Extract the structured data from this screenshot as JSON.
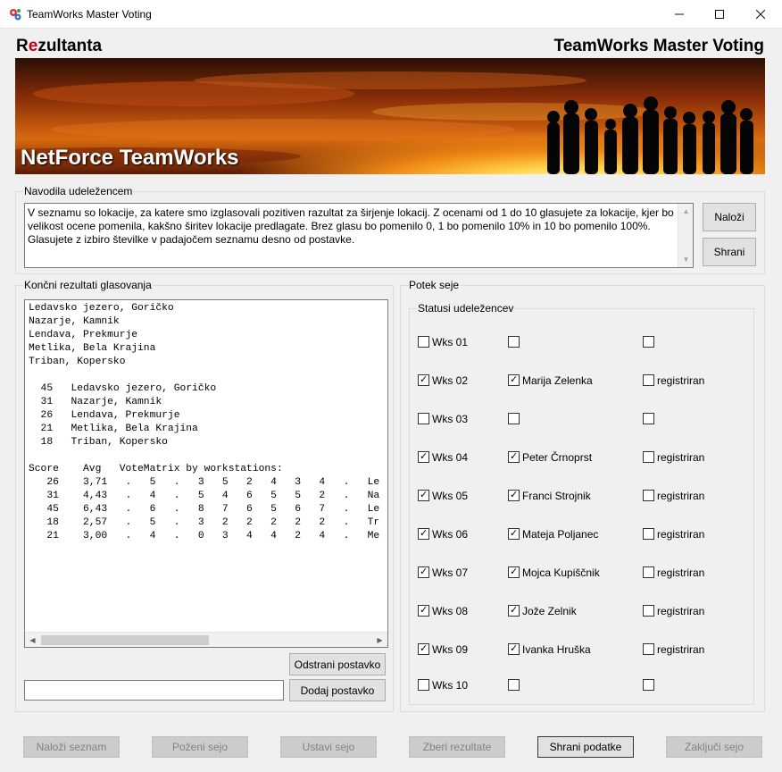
{
  "window": {
    "title": "TeamWorks Master Voting"
  },
  "header": {
    "brand_left_first": "R",
    "brand_left_accent": "e",
    "brand_left_rest": "zultanta",
    "brand_right": "TeamWorks Master Voting",
    "banner_logo": "NetForce TeamWorks"
  },
  "instructions": {
    "label": "Navodila udeležencem",
    "text": "V seznamu so lokacije, za katere smo izglasovali pozitiven razultat za širjenje lokacij. Z ocenami od 1 do 10 glasujete za lokacije, kjer bo velikost ocene pomenila, kakšno širitev lokacije predlagate. Brez glasu bo pomenilo 0, 1 bo pomenilo 10% in 10 bo pomenilo 100%. Glasujete z izbiro številke v padajočem seznamu desno od postavke.",
    "load_button": "Naloži",
    "save_button": "Shrani"
  },
  "results": {
    "label": "Končni rezultati glasovanja",
    "text": "Ledavsko jezero, Goričko\nNazarje, Kamnik\nLendava, Prekmurje\nMetlika, Bela Krajina\nTriban, Kopersko\n\n  45   Ledavsko jezero, Goričko\n  31   Nazarje, Kamnik\n  26   Lendava, Prekmurje\n  21   Metlika, Bela Krajina\n  18   Triban, Kopersko\n\nScore    Avg   VoteMatrix by workstations:\n   26    3,71   .   5   .   3   5   2   4   3   4   .   Le\n   31    4,43   .   4   .   5   4   6   5   5   2   .   Na\n   45    6,43   .   6   .   8   7   6   5   6   7   .   Le\n   18    2,57   .   5   .   3   2   2   2   2   2   .   Tr\n   21    3,00   .   4   .   0   3   4   4   2   4   .   Me",
    "remove_button": "Odstrani postavko",
    "add_button": "Dodaj postavko",
    "new_item_value": ""
  },
  "session": {
    "label": "Potek seje",
    "status_label": "Statusi udeležencev",
    "rows": [
      {
        "wks": "Wks 01",
        "wks_checked": false,
        "name": "",
        "name_checked": false,
        "status": "",
        "status_checked": false
      },
      {
        "wks": "Wks 02",
        "wks_checked": true,
        "name": "Marija Zelenka",
        "name_checked": true,
        "status": "registriran",
        "status_checked": false
      },
      {
        "wks": "Wks 03",
        "wks_checked": false,
        "name": "",
        "name_checked": false,
        "status": "",
        "status_checked": false
      },
      {
        "wks": "Wks 04",
        "wks_checked": true,
        "name": "Peter Črnoprst",
        "name_checked": true,
        "status": "registriran",
        "status_checked": false
      },
      {
        "wks": "Wks 05",
        "wks_checked": true,
        "name": "Franci Strojnik",
        "name_checked": true,
        "status": "registriran",
        "status_checked": false
      },
      {
        "wks": "Wks 06",
        "wks_checked": true,
        "name": "Mateja Poljanec",
        "name_checked": true,
        "status": "registriran",
        "status_checked": false
      },
      {
        "wks": "Wks 07",
        "wks_checked": true,
        "name": "Mojca Kupiščnik",
        "name_checked": true,
        "status": "registriran",
        "status_checked": false
      },
      {
        "wks": "Wks 08",
        "wks_checked": true,
        "name": "Jože Zelnik",
        "name_checked": true,
        "status": "registriran",
        "status_checked": false
      },
      {
        "wks": "Wks 09",
        "wks_checked": true,
        "name": "Ivanka Hruška",
        "name_checked": true,
        "status": "registriran",
        "status_checked": false
      },
      {
        "wks": "Wks 10",
        "wks_checked": false,
        "name": "",
        "name_checked": false,
        "status": "",
        "status_checked": false
      }
    ]
  },
  "footer": {
    "load_list": "Naloži seznam",
    "start_session": "Poženi sejo",
    "stop_session": "Ustavi sejo",
    "collect_results": "Zberi rezultate",
    "save_data": "Shrani podatke",
    "close_session": "Zaključi sejo"
  }
}
